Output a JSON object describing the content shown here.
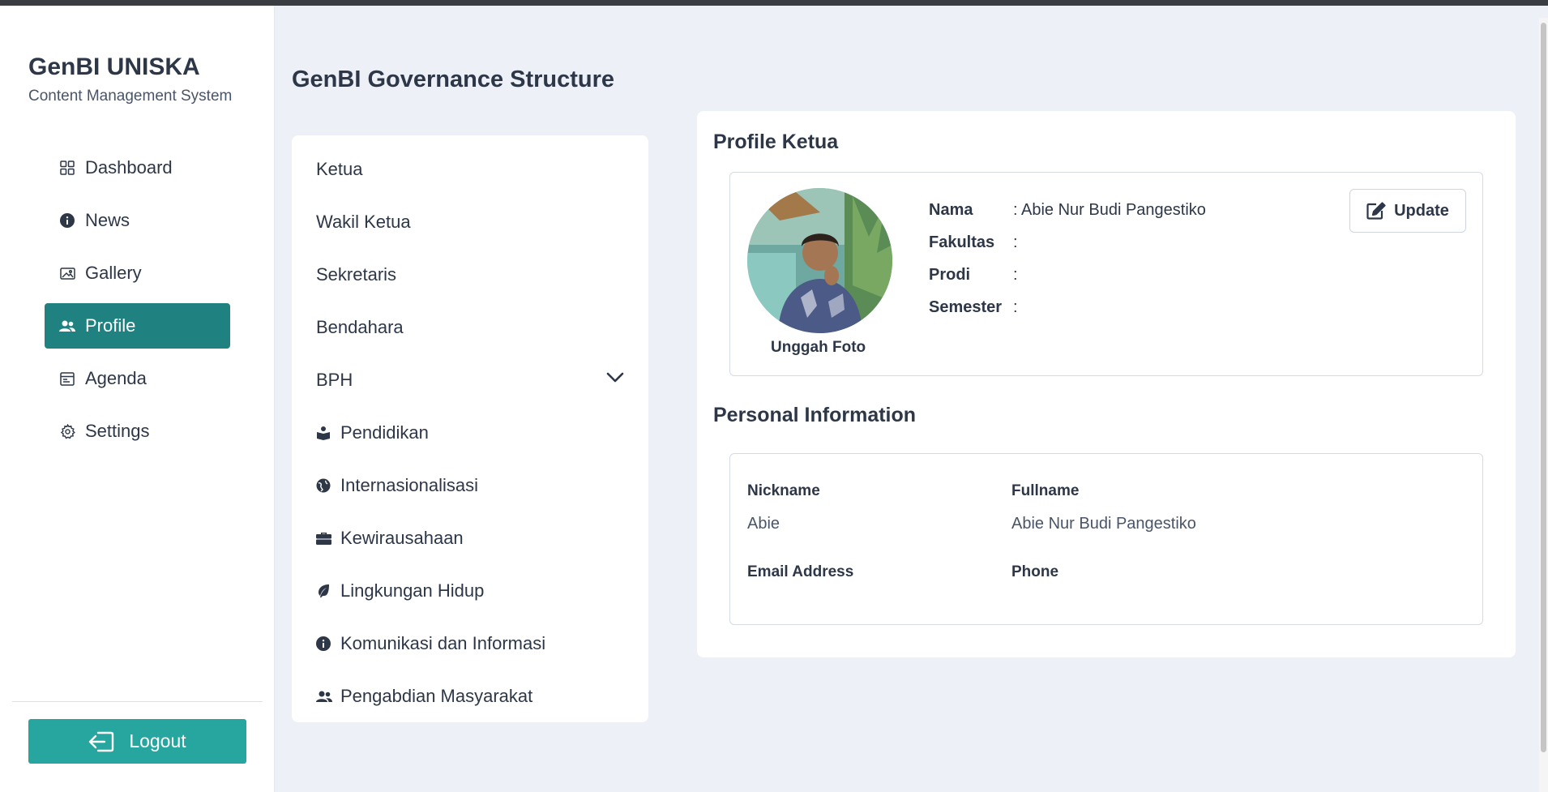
{
  "brand": {
    "title": "GenBI UNISKA",
    "subtitle": "Content Management System"
  },
  "sidebar": {
    "items": [
      {
        "label": "Dashboard",
        "icon": "grid-icon",
        "active": false
      },
      {
        "label": "News",
        "icon": "info-circle-icon",
        "active": false
      },
      {
        "label": "Gallery",
        "icon": "images-icon",
        "active": false
      },
      {
        "label": "Profile",
        "icon": "people-icon",
        "active": true
      },
      {
        "label": "Agenda",
        "icon": "calendar-icon",
        "active": false
      },
      {
        "label": "Settings",
        "icon": "gear-icon",
        "active": false
      }
    ],
    "logout_label": "Logout"
  },
  "page": {
    "title": "GenBI Governance Structure"
  },
  "structure": {
    "items": [
      {
        "label": "Ketua"
      },
      {
        "label": "Wakil Ketua"
      },
      {
        "label": "Sekretaris"
      },
      {
        "label": "Bendahara"
      },
      {
        "label": "BPH",
        "expandable": true
      },
      {
        "label": "Pendidikan",
        "icon": "book-reader-icon"
      },
      {
        "label": "Internasionalisasi",
        "icon": "globe-icon"
      },
      {
        "label": "Kewirausahaan",
        "icon": "briefcase-icon"
      },
      {
        "label": "Lingkungan Hidup",
        "icon": "leaf-icon"
      },
      {
        "label": "Komunikasi dan Informasi",
        "icon": "info-circle-icon"
      },
      {
        "label": "Pengabdian Masyarakat",
        "icon": "people-icon"
      }
    ]
  },
  "profile": {
    "section_title": "Profile Ketua",
    "upload_label": "Unggah Foto",
    "update_label": "Update",
    "fields": [
      {
        "key": "Nama",
        "value": ": Abie Nur Budi Pangestiko"
      },
      {
        "key": "Fakultas",
        "value": ":"
      },
      {
        "key": "Prodi",
        "value": ":"
      },
      {
        "key": "Semester",
        "value": ":"
      }
    ]
  },
  "personal": {
    "section_title": "Personal Information",
    "nickname_label": "Nickname",
    "nickname_value": "Abie",
    "fullname_label": "Fullname",
    "fullname_value": "Abie Nur Budi Pangestiko",
    "email_label": "Email Address",
    "email_value": "",
    "phone_label": "Phone",
    "phone_value": ""
  },
  "colors": {
    "accent": "#1f8280",
    "logout": "#26a69f",
    "background": "#edf0f6"
  }
}
